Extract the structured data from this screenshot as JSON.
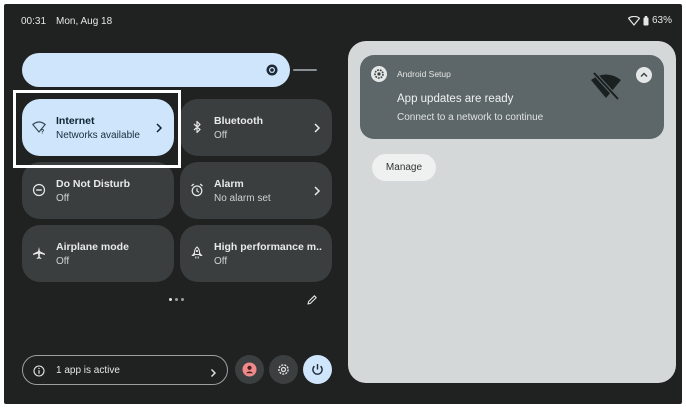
{
  "status_bar": {
    "time": "00:31",
    "date": "Mon, Aug 18",
    "battery": "63%",
    "wifi_icon": "wifi-outline-icon",
    "battery_icon": "battery-icon"
  },
  "brightness": {
    "icon": "brightness-icon",
    "level": 0.86
  },
  "tiles": [
    {
      "title": "Internet",
      "subtitle": "Networks available",
      "icon": "wifi-unknown-icon",
      "active": true,
      "chevron": true
    },
    {
      "title": "Bluetooth",
      "subtitle": "Off",
      "icon": "bluetooth-icon",
      "active": false,
      "chevron": true
    },
    {
      "title": "Do Not Disturb",
      "subtitle": "Off",
      "icon": "do-not-disturb-icon",
      "active": false,
      "chevron": false
    },
    {
      "title": "Alarm",
      "subtitle": "No alarm set",
      "icon": "alarm-icon",
      "active": false,
      "chevron": true
    },
    {
      "title": "Airplane mode",
      "subtitle": "Off",
      "icon": "airplane-icon",
      "active": false,
      "chevron": false
    },
    {
      "title": "High performance m..",
      "subtitle": "Off",
      "icon": "rocket-icon",
      "active": false,
      "chevron": false
    }
  ],
  "pager": {
    "pages": 3,
    "current": 1
  },
  "footer": {
    "active_apps_label": "1 app is active",
    "user_icon": "user-icon",
    "settings_icon": "settings-icon",
    "power_icon": "power-icon"
  },
  "notification": {
    "app_name": "Android Setup",
    "title": "App updates are ready",
    "body": "Connect to a network to continue",
    "big_icon": "wifi-off-icon",
    "action_label": "Manage"
  },
  "colors": {
    "background": "#202221",
    "tile": "#3a3e3e",
    "tile_active": "#cfe5fb",
    "panel": "#d5d8d8",
    "card": "#5d6668"
  }
}
